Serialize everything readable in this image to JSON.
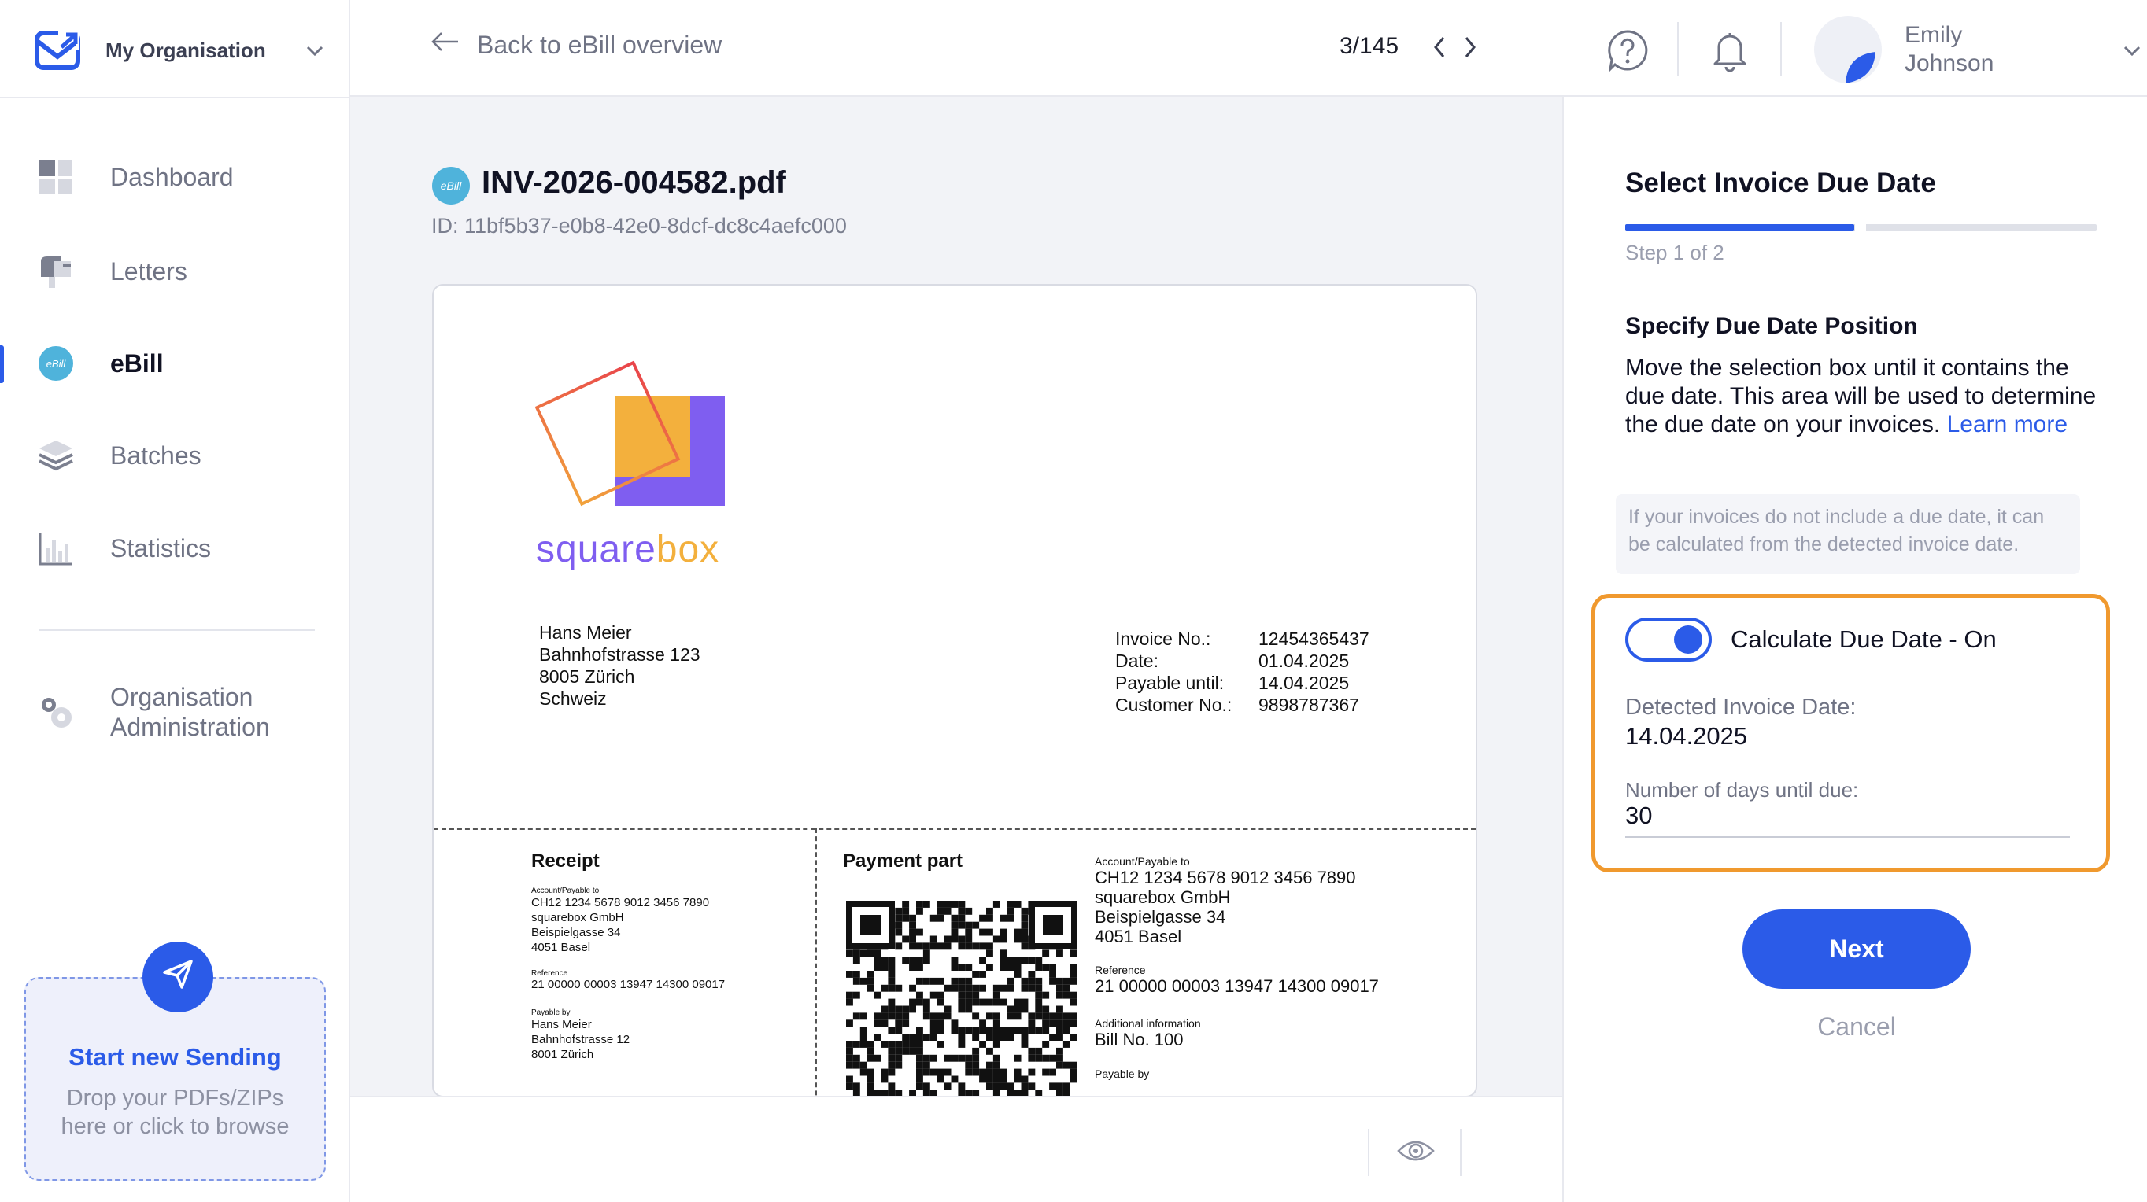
{
  "org": {
    "name": "My Organisation"
  },
  "nav": {
    "dashboard": "Dashboard",
    "letters": "Letters",
    "ebill": "eBill",
    "batches": "Batches",
    "statistics": "Statistics",
    "org_admin_line1": "Organisation",
    "org_admin_line2": "Administration"
  },
  "upload": {
    "title": "Start new Sending",
    "hint_line1": "Drop your PDFs/ZIPs",
    "hint_line2": "here or click to browse"
  },
  "topbar": {
    "back_label": "Back to eBill overview",
    "pager": "3/145",
    "user_first": "Emily",
    "user_last": "Johnson"
  },
  "document": {
    "badge": "eBill",
    "filename": "INV-2026-004582.pdf",
    "id": "ID: 11bf5b37-e0b8-42e0-8dcf-dc8c4aefc000"
  },
  "invoice": {
    "logo_text_a": "square",
    "logo_text_b": "box",
    "recipient": [
      "Hans Meier",
      "Bahnhofstrasse 123",
      "8005 Zürich",
      "Schweiz"
    ],
    "meta_labels": [
      "Invoice No.:",
      "Date:",
      "Payable until:",
      "Customer No.:"
    ],
    "meta_values": [
      "12454365437",
      "01.04.2025",
      "14.04.2025",
      "9898787367"
    ],
    "receipt": {
      "title": "Receipt",
      "account_label": "Account/Payable to",
      "account_lines": [
        "CH12 1234 5678 9012 3456 7890",
        "squarebox GmbH",
        "Beispielgasse 34",
        "4051 Basel"
      ],
      "reference_label": "Reference",
      "reference": "21 00000 00003 13947 14300 09017",
      "payable_by_label": "Payable by",
      "payable_by_lines": [
        "Hans Meier",
        "Bahnhofstrasse 12",
        "8001 Zürich"
      ]
    },
    "payment": {
      "title": "Payment part",
      "account_label": "Account/Payable to",
      "account_lines": [
        "CH12 1234 5678 9012 3456 7890",
        "squarebox GmbH",
        "Beispielgasse 34",
        "4051 Basel"
      ],
      "reference_label": "Reference",
      "reference": "21 00000 00003 13947 14300 09017",
      "additional_label": "Additional information",
      "additional": "Bill No. 100",
      "payable_by_label": "Payable by"
    }
  },
  "panel": {
    "title": "Select Invoice Due Date",
    "step": "Step 1 of 2",
    "step_progress": 0.5,
    "section_title": "Specify Due Date Position",
    "description": "Move the selection box until it contains the due date. This area will be used to determine the due date on your invoices.",
    "learn_more": "Learn more",
    "hint": "If your invoices do not include a due date, it can be calculated from the detected invoice date.",
    "toggle_label": "Calculate Due Date - On",
    "toggle_on": true,
    "detected_label": "Detected Invoice Date:",
    "detected_value": "14.04.2025",
    "days_label": "Number of days until due:",
    "days_value": "30",
    "next": "Next",
    "cancel": "Cancel"
  },
  "colors": {
    "accent": "#2b5be8",
    "highlight": "#f0992e",
    "ebill_badge": "#4fb3db",
    "logo_orange": "#f3b03d",
    "logo_purple": "#7f5ef0",
    "logo_outline_a": "#f1a23c",
    "logo_outline_b": "#e9444b"
  },
  "icons": [
    "logo-icon",
    "chevron-down-icon",
    "dashboard-icon",
    "letters-icon",
    "ebill-icon",
    "batches-icon",
    "statistics-icon",
    "settings-icon",
    "send-icon",
    "arrow-left-icon",
    "chevron-left-icon",
    "chevron-right-icon",
    "help-icon",
    "bell-icon",
    "avatar",
    "eye-icon",
    "qr-code"
  ]
}
